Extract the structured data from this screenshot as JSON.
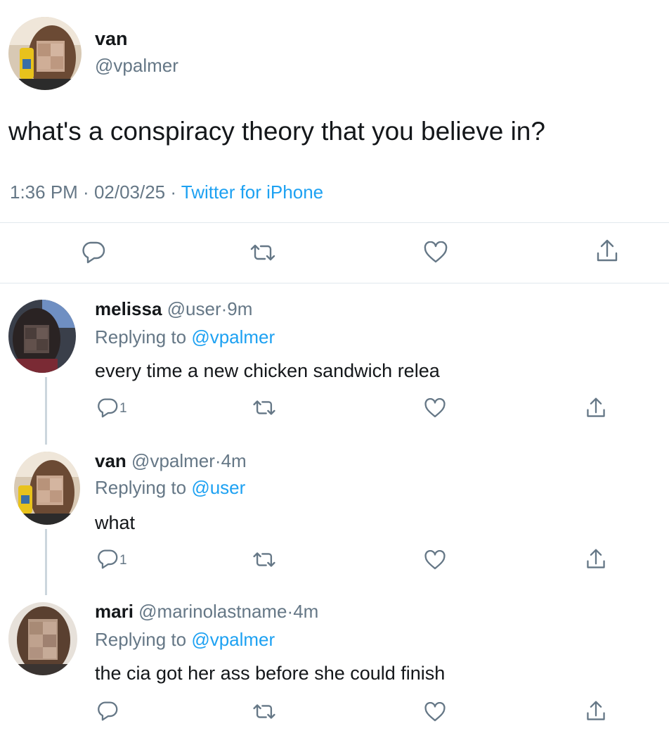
{
  "tweet": {
    "author_name": "van",
    "author_handle": "@vpalmer",
    "text": "what's a conspiracy theory that you believe in?",
    "time": "1:36 PM",
    "date": "02/03/25",
    "source": "Twitter for iPhone",
    "separator": " · ",
    "actions": [
      "reply-icon",
      "retweet-icon",
      "like-icon",
      "share-icon"
    ]
  },
  "replies": [
    {
      "name": "melissa",
      "handle": "@user",
      "time": "9m",
      "replying_prefix": "Replying to",
      "replying_to": "@vpalmer",
      "text": "every time a new chicken sandwich relea",
      "reply_count": "1"
    },
    {
      "name": "van",
      "handle": "@vpalmer",
      "time": "4m",
      "replying_prefix": "Replying to",
      "replying_to": "@user",
      "text": "what",
      "reply_count": "1"
    },
    {
      "name": "mari",
      "handle": "@marinolastname",
      "time": "4m",
      "replying_prefix": "Replying to",
      "replying_to": "@vpalmer",
      "text": "the cia got her ass before she could finish",
      "reply_count": ""
    }
  ],
  "colors": {
    "link": "#1da1f2",
    "muted": "#657786",
    "text": "#14171a",
    "divider": "#e1e8ed"
  }
}
